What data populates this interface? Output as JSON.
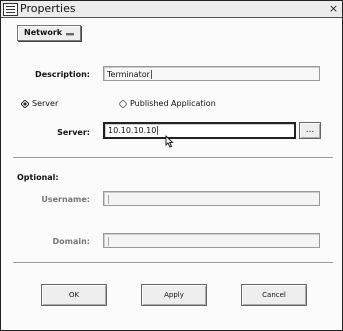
{
  "window": {
    "title": "Properties",
    "close_glyph": "×"
  },
  "category_dropdown": {
    "selected": "Network"
  },
  "description": {
    "label": "Description:",
    "value": "Terminator"
  },
  "app_type": {
    "options": [
      {
        "label": "Server",
        "selected": true
      },
      {
        "label": "Published Application",
        "selected": false
      }
    ]
  },
  "server": {
    "label": "Server:",
    "value": "10.10.10.10",
    "browse_label": "..."
  },
  "optional": {
    "section_label": "Optional:",
    "username_label": "Username:",
    "username_value": "",
    "domain_label": "Domain:",
    "domain_value": ""
  },
  "buttons": {
    "ok": "OK",
    "apply": "Apply",
    "cancel": "Cancel"
  },
  "icons": [
    "window-menu-icon",
    "close-icon",
    "chevron-down-icon",
    "radio-icon",
    "mouse-cursor-icon"
  ]
}
